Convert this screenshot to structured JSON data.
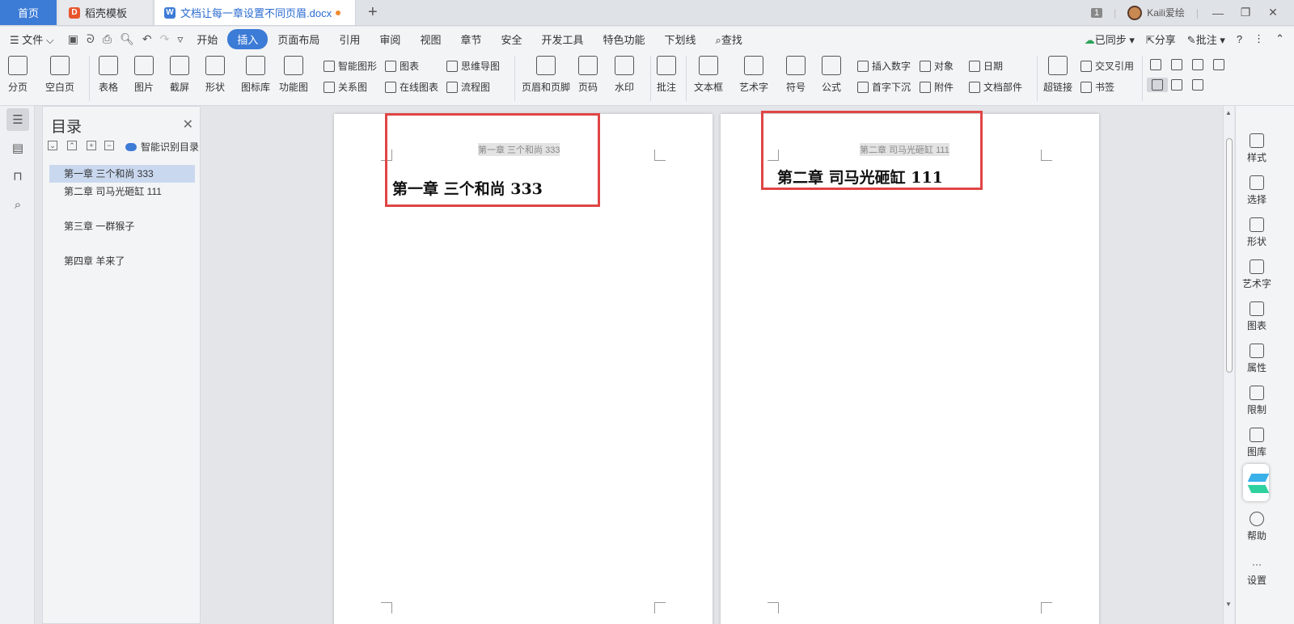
{
  "titlebar": {
    "tab_home": "首页",
    "tab_template": "稻壳模板",
    "tab_document": "文档让每一章设置不同页眉.docx",
    "page_badge": "1",
    "user_name": "Kaili爱绘"
  },
  "menubar": {
    "file": "文件",
    "items": [
      "开始",
      "插入",
      "页面布局",
      "引用",
      "审阅",
      "视图",
      "章节",
      "安全",
      "开发工具",
      "特色功能",
      "下划线"
    ],
    "active": "插入",
    "search": "查找",
    "sync": "已同步",
    "share": "分享",
    "comment": "批注"
  },
  "ribbon": {
    "page_break": "分页",
    "blank_page": "空白页",
    "table": "表格",
    "picture": "图片",
    "screenshot": "截屏",
    "shapes": "形状",
    "icon_library": "图标库",
    "feature_chart": "功能图",
    "smart_shape": "智能图形",
    "chart": "图表",
    "mind_map": "思维导图",
    "relation_chart": "关系图",
    "online_chart": "在线图表",
    "flowchart": "流程图",
    "header_footer": "页眉和页脚",
    "page_number": "页码",
    "watermark": "水印",
    "comment": "批注",
    "text_box": "文本框",
    "word_art": "艺术字",
    "symbol": "符号",
    "formula": "公式",
    "insert_number": "插入数字",
    "object": "对象",
    "date": "日期",
    "drop_cap": "首字下沉",
    "attachment": "附件",
    "doc_parts": "文档部件",
    "hyperlink": "超链接",
    "cross_ref": "交叉引用",
    "bookmark": "书签"
  },
  "toc": {
    "title": "目录",
    "smart_recognize": "智能识别目录",
    "items": [
      "第一章  三个和尚 333",
      "第二章  司马光砸缸 111",
      "第三章  一群猴子",
      "第四章  羊来了"
    ]
  },
  "pages": [
    {
      "header": "第一章  三个和尚 333",
      "heading": "第一章  三个和尚 333"
    },
    {
      "header": "第二章  司马光砸缸 111",
      "heading": "第二章  司马光砸缸 111"
    }
  ],
  "rightpanel": {
    "items": [
      "样式",
      "选择",
      "形状",
      "艺术字",
      "图表",
      "属性",
      "限制",
      "图库",
      "帮助",
      "设置"
    ]
  },
  "colors": {
    "accent": "#3c7bd6",
    "highlight_box": "#e04545",
    "toc_selected": "#c9d8ef"
  }
}
